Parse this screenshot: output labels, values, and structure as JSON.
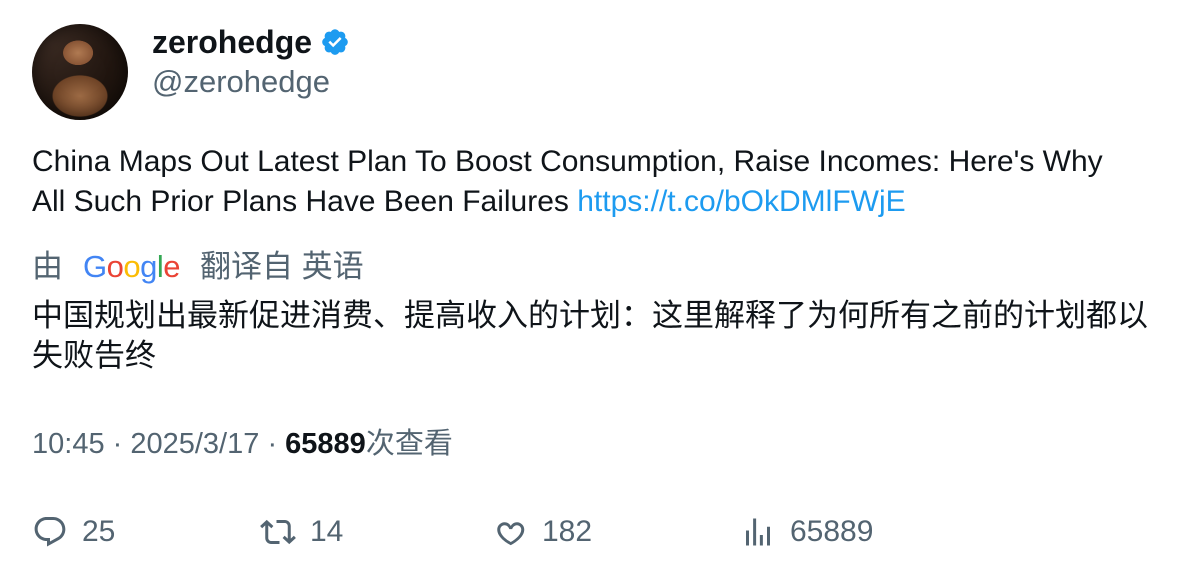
{
  "user": {
    "display_name": "zerohedge",
    "handle": "@zerohedge",
    "verified": true
  },
  "tweet": {
    "text": "China Maps Out Latest Plan To Boost Consumption, Raise Incomes: Here's Why All Such Prior Plans Have Been Failures ",
    "link": "https://t.co/bOkDMlFWjE"
  },
  "translation": {
    "prefix": "由",
    "provider": "Google",
    "suffix": "翻译自 英语",
    "text": "中国规划出最新促进消费、提高收入的计划：这里解释了为何所有之前的计划都以失败告终"
  },
  "meta": {
    "time": "10:45",
    "date": "2025/3/17",
    "views": "65889",
    "views_label": "次查看"
  },
  "actions": {
    "replies": "25",
    "retweets": "14",
    "likes": "182",
    "views": "65889"
  },
  "colors": {
    "link": "#1d9bf0",
    "secondary_text": "#536471",
    "verified_badge": "#1d9bf0"
  }
}
